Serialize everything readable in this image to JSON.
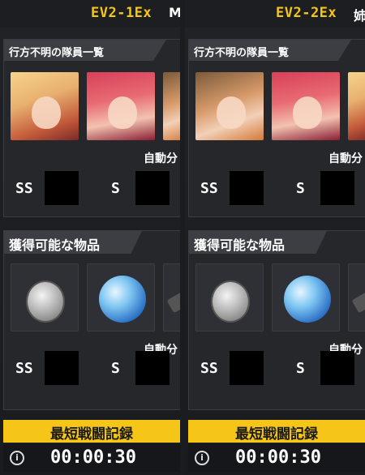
{
  "columns": [
    {
      "stage": "EV2-1Ex",
      "stage_extra": "M",
      "members_title": "行方不明の隊員一覧",
      "items_title": "獲得可能な物品",
      "auto_label": "自動分",
      "rank_ss": "SS",
      "rank_s": "S",
      "record_label": "最短戦闘記録",
      "record_time": "00:00:30",
      "info_glyph": "i"
    },
    {
      "stage": "EV2-2Ex",
      "stage_extra": "姉",
      "members_title": "行方不明の隊員一覧",
      "items_title": "獲得可能な物品",
      "auto_label": "自動分",
      "rank_ss": "SS",
      "rank_s": "S",
      "record_label": "最短戦闘記録",
      "record_time": "00:00:30",
      "info_glyph": "i"
    }
  ],
  "colors": {
    "accent": "#f5c518",
    "panel": "#25272b",
    "background": "#1b1c1f"
  },
  "icons": [
    "info-icon",
    "pendant-icon",
    "orb-icon",
    "weapon-icon"
  ]
}
